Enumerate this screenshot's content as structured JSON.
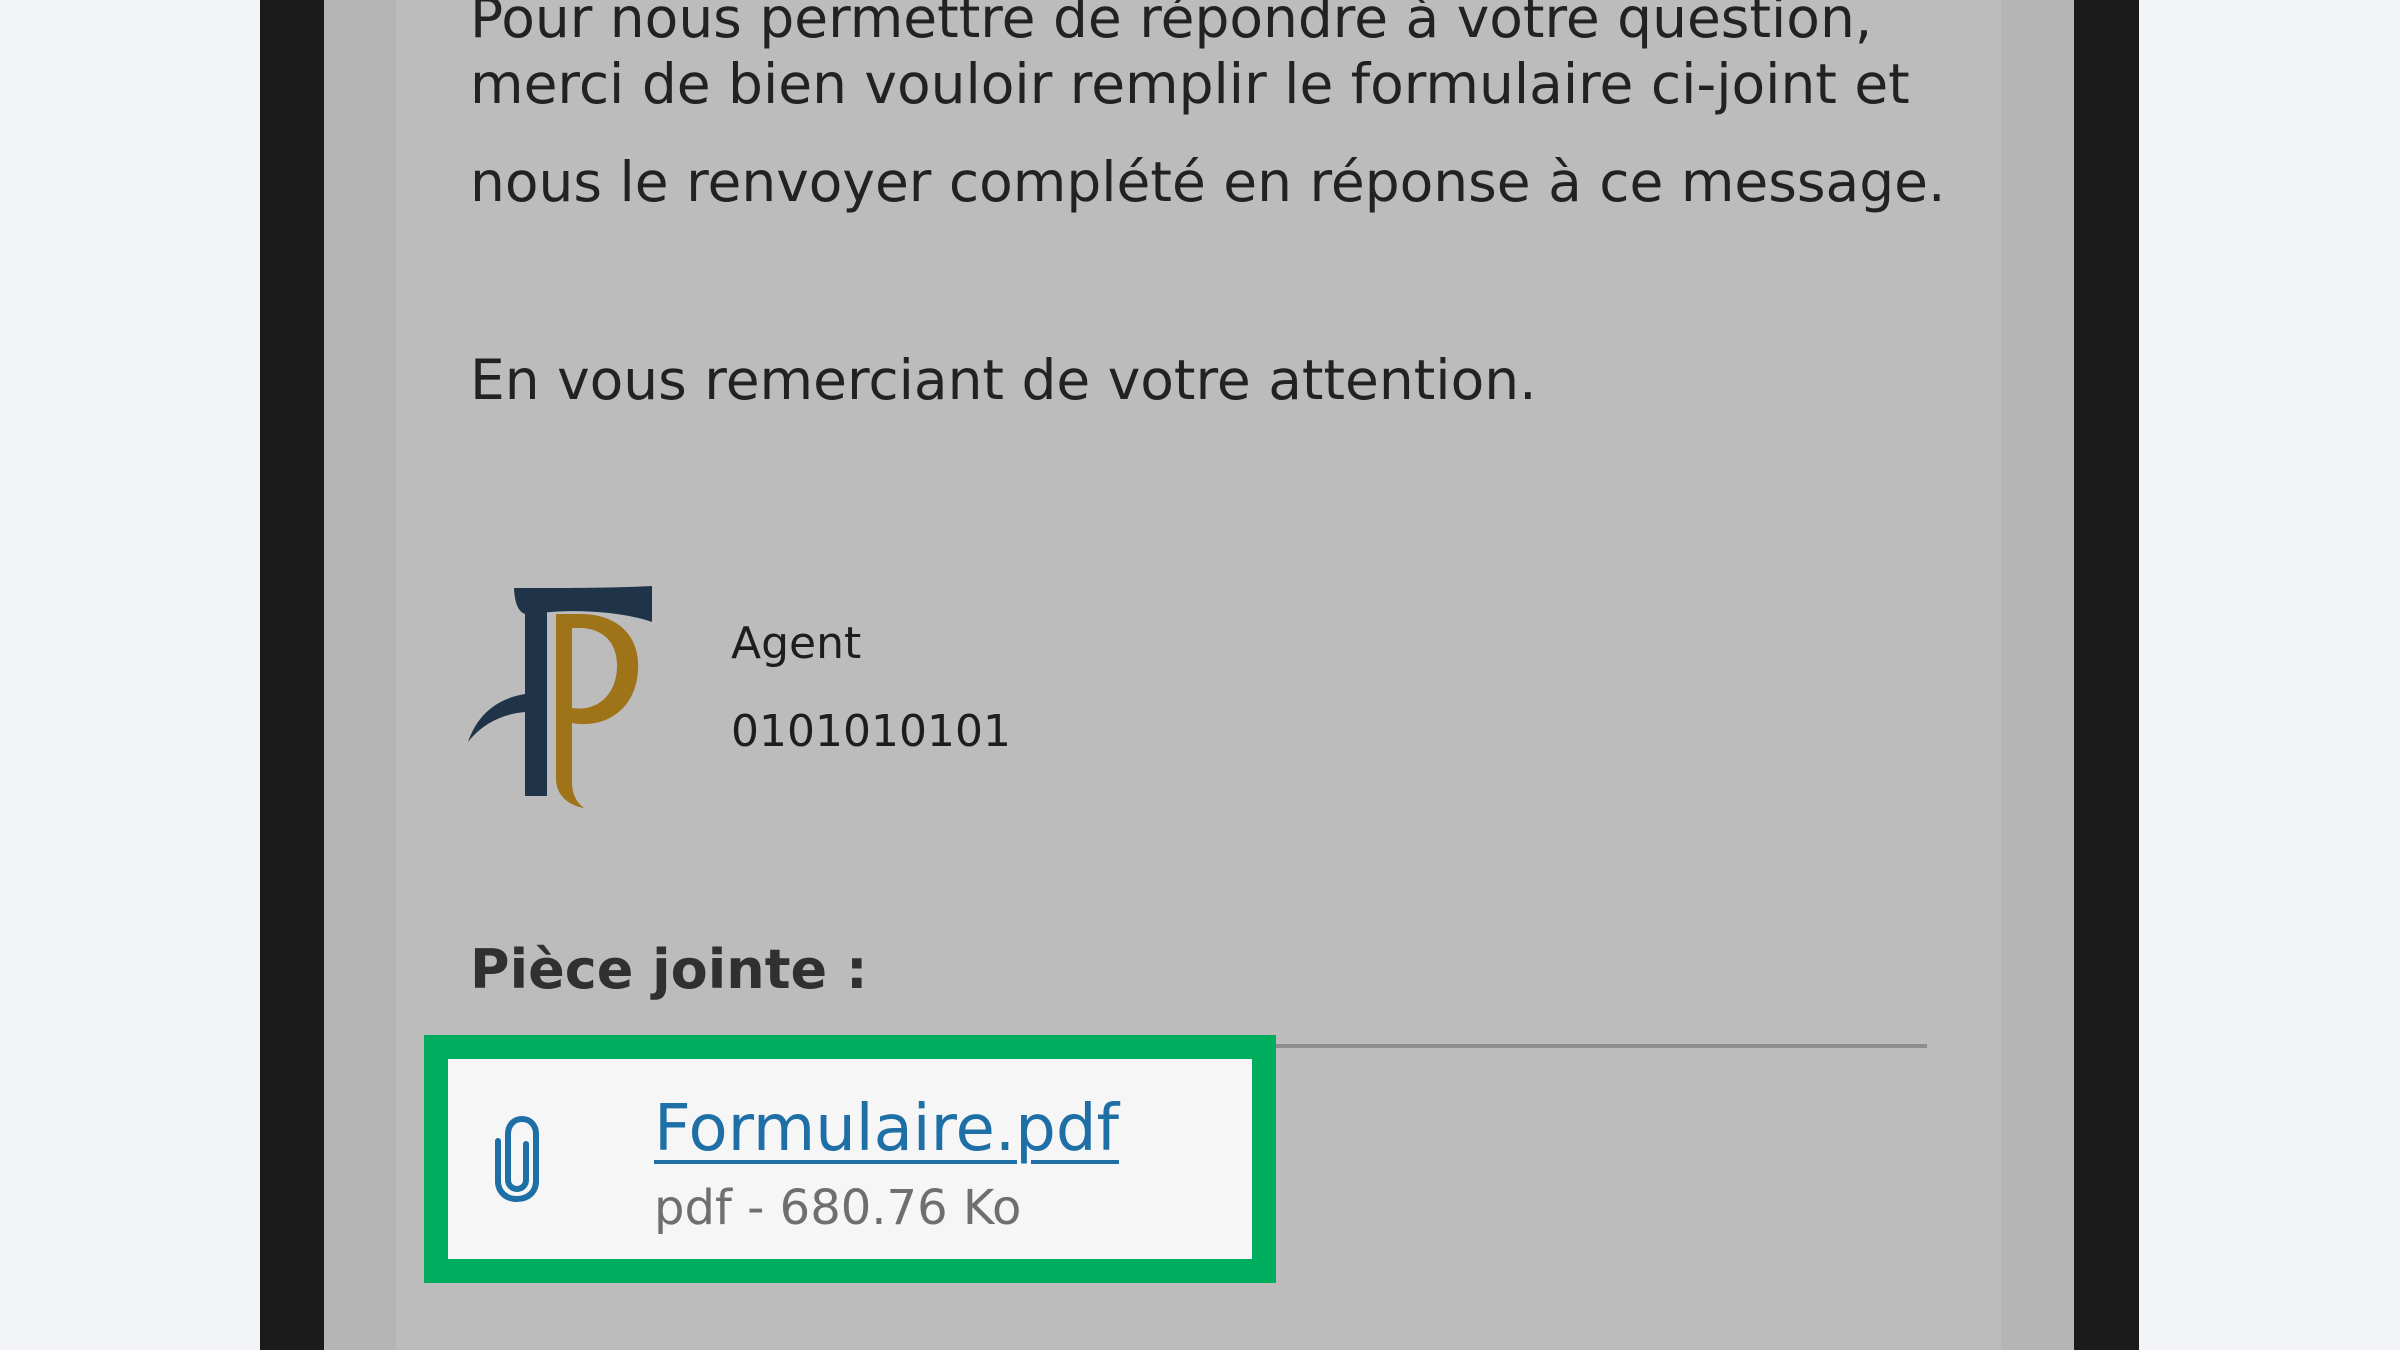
{
  "message": {
    "lines": [
      "Pour nous permettre de répondre à votre question,",
      "merci de bien vouloir remplir le formulaire ci-joint et",
      "nous le renvoyer complété en réponse à ce message."
    ],
    "closing": "En vous remerciant de votre attention."
  },
  "signature": {
    "role": "Agent",
    "id": "0101010101"
  },
  "attachments": {
    "heading": "Pièce jointe :",
    "file": {
      "name": "Formulaire.pdf",
      "meta": "pdf - 680.76 Ko",
      "icon": "paperclip-icon"
    }
  },
  "colors": {
    "link": "#1d6fa5",
    "highlight": "#00ad5f",
    "logo_navy": "#1f3448",
    "logo_gold": "#9f7418"
  }
}
